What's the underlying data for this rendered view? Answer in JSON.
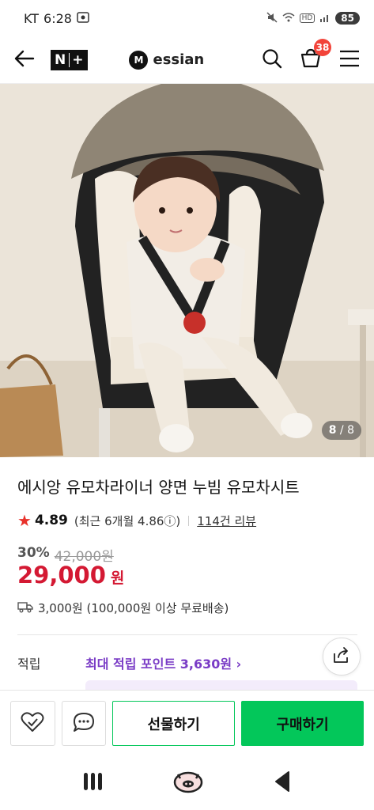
{
  "status": {
    "carrier": "KT",
    "time": "6:28",
    "battery": "85"
  },
  "header": {
    "nplus_left": "N",
    "nplus_right": "+",
    "brand_name": "essian",
    "brand_logo_letter": "M",
    "cart_count": "38"
  },
  "hero": {
    "counter_current": "8",
    "counter_total": "8",
    "icons": [
      "back-arrow-icon",
      "search-icon",
      "cart-icon",
      "menu-icon"
    ]
  },
  "product": {
    "title": "에시앙 유모차라이너 양면 누빔 유모차시트",
    "rating": "4.89",
    "recent_rating": "(최근 6개월 4.86ⓘ)",
    "review_count": "114건 리뷰",
    "discount_pct": "30%",
    "original_price": "42,000원",
    "price": "29,000",
    "price_unit": "원",
    "shipping": "3,000원 (100,000원 이상 무료배송)"
  },
  "points": {
    "label": "적립",
    "value": "최대 적립 포인트 3,630원 ›"
  },
  "actions": {
    "gift_label": "선물하기",
    "buy_label": "구매하기"
  },
  "colors": {
    "accent_green": "#03c75a",
    "price_red": "#d41933",
    "points_purple": "#7a3cc6",
    "star_red": "#e8322b"
  }
}
